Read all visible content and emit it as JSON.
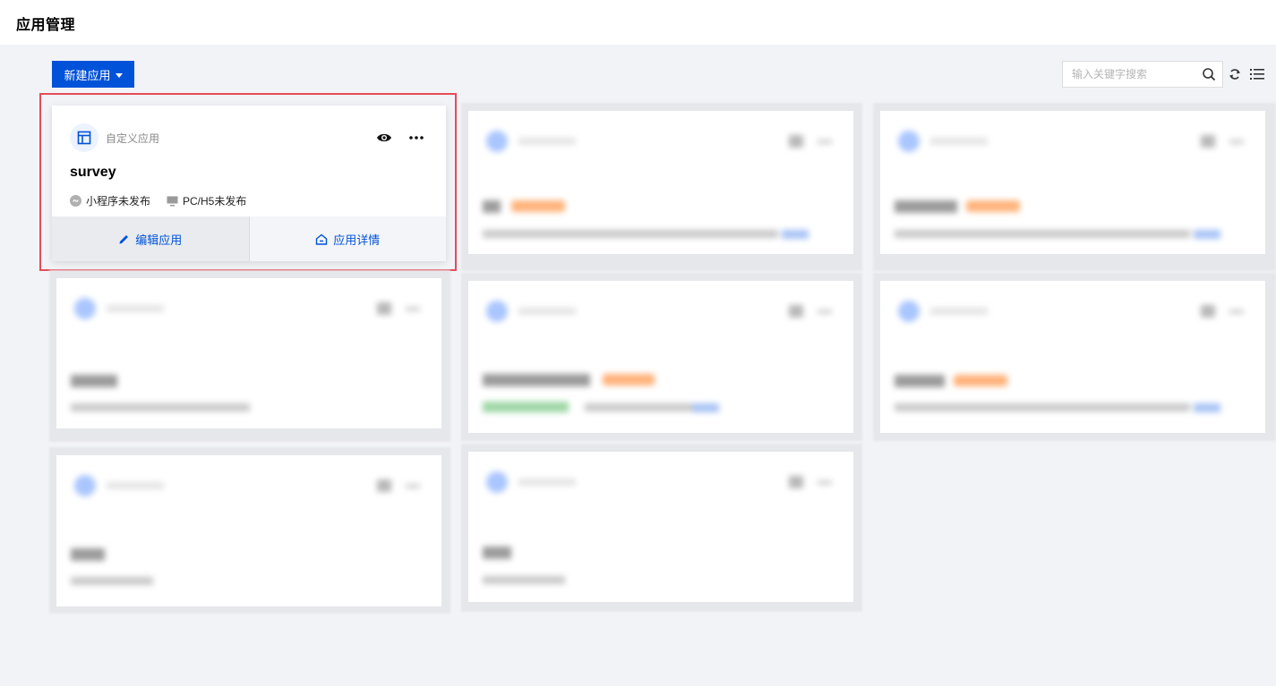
{
  "header": {
    "title": "应用管理"
  },
  "toolbar": {
    "new_app_label": "新建应用",
    "search_placeholder": "输入关键字搜索"
  },
  "main_card": {
    "type_label": "自定义应用",
    "name": "survey",
    "status_miniprogram": "小程序未发布",
    "status_pc_h5": "PC/H5未发布",
    "edit_label": "编辑应用",
    "detail_label": "应用详情"
  },
  "colors": {
    "accent": "#0052d9",
    "highlight_border": "#e34d59",
    "page_bg": "#f2f3f7"
  }
}
